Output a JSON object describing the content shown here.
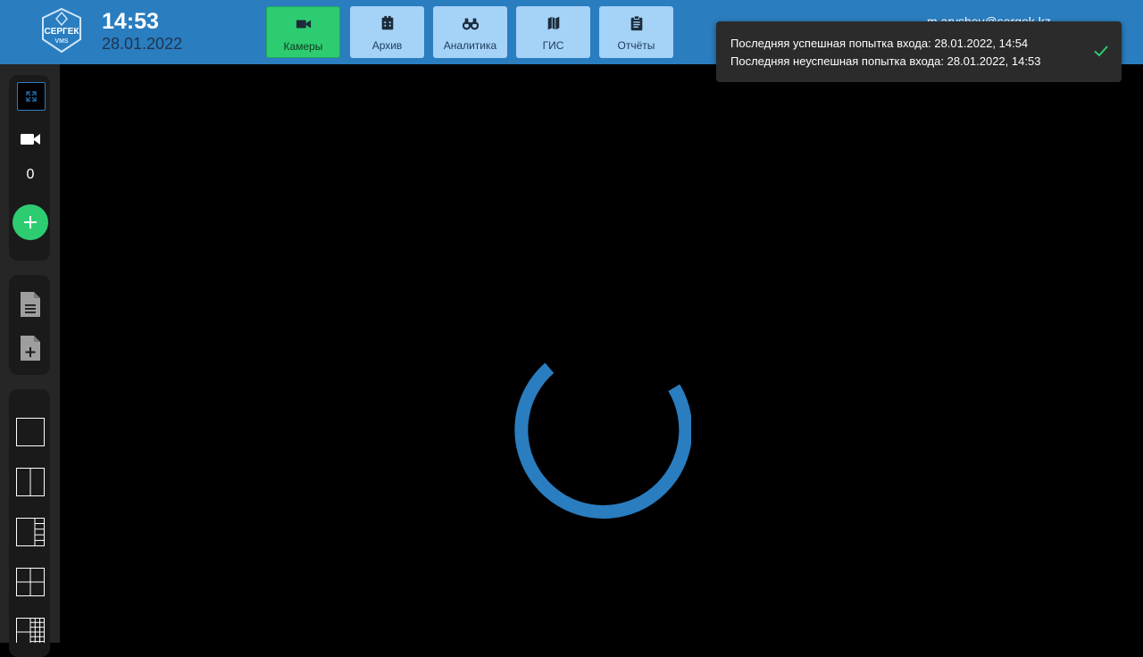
{
  "header": {
    "logo_text": "СЕРГЕК",
    "logo_sub": "VMS",
    "time": "14:53",
    "date": "28.01.2022",
    "user_email": "m.aryshev@sergek.kz"
  },
  "nav": [
    {
      "label": "Камеры",
      "icon": "video-camera-icon",
      "active": true
    },
    {
      "label": "Архив",
      "icon": "film-archive-icon",
      "active": false
    },
    {
      "label": "Аналитика",
      "icon": "binoculars-icon",
      "active": false
    },
    {
      "label": "ГИС",
      "icon": "map-icon",
      "active": false
    },
    {
      "label": "Отчёты",
      "icon": "clipboard-icon",
      "active": false
    }
  ],
  "toast": {
    "line1": "Последняя успешная попытка входа: 28.01.2022, 14:54",
    "line2": "Последняя неуспешная попытка входа: 28.01.2022, 14:53"
  },
  "sidebar": {
    "camera_count": "0"
  },
  "colors": {
    "header_bg": "#2a7dbf",
    "accent_green": "#2ecc71",
    "spinner": "#2a7dbf",
    "nav_inactive": "#a5d2f7"
  }
}
